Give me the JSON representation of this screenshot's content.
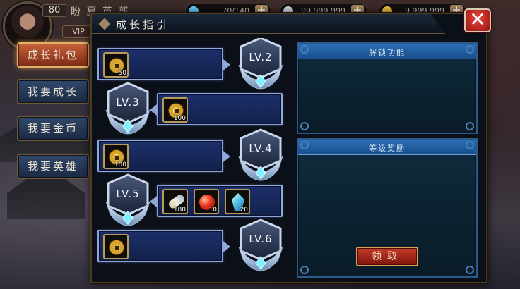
{
  "player": {
    "level": "80",
    "name": "盼 夏 英 部",
    "vip": "VIP"
  },
  "resources": [
    {
      "icon": "stamina-icon",
      "value": "70/140",
      "color": "#6bd0ff"
    },
    {
      "icon": "gem-icon",
      "value": "99,999,999",
      "color": "#d8d8e8"
    },
    {
      "icon": "gold-icon",
      "value": "9,999,999",
      "color": "#f0c040"
    }
  ],
  "sidebar": {
    "items": [
      {
        "label": "成长礼包",
        "active": true
      },
      {
        "label": "我要成长",
        "active": false
      },
      {
        "label": "我要金币",
        "active": false
      },
      {
        "label": "我要英雄",
        "active": false
      }
    ]
  },
  "dialog": {
    "title": "成长指引",
    "close_icon": "close-icon"
  },
  "growth_track": [
    {
      "level": "LV.2",
      "side": "left",
      "rewards": [
        {
          "type": "coin",
          "qty": "50"
        }
      ]
    },
    {
      "level": "LV.3",
      "side": "right",
      "rewards": [
        {
          "type": "coin",
          "qty": "100"
        }
      ]
    },
    {
      "level": "LV.4",
      "side": "left",
      "rewards": [
        {
          "type": "coin",
          "qty": "100"
        }
      ]
    },
    {
      "level": "LV.5",
      "side": "right",
      "rewards": [
        {
          "type": "scroll",
          "qty": "180"
        },
        {
          "type": "potion",
          "qty": "10"
        },
        {
          "type": "crystal",
          "qty": "20"
        }
      ]
    },
    {
      "level": "LV.6",
      "side": "left",
      "rewards": [
        {
          "type": "coin",
          "qty": ""
        }
      ]
    }
  ],
  "panels": {
    "unlock": {
      "title": "解锁功能"
    },
    "reward": {
      "title": "等级奖励"
    }
  },
  "claim_button": {
    "label": "领取"
  },
  "colors": {
    "accent_gold": "#e0a25a",
    "active_tab": "#c7623a",
    "panel_blue": "#2a6fb6"
  }
}
